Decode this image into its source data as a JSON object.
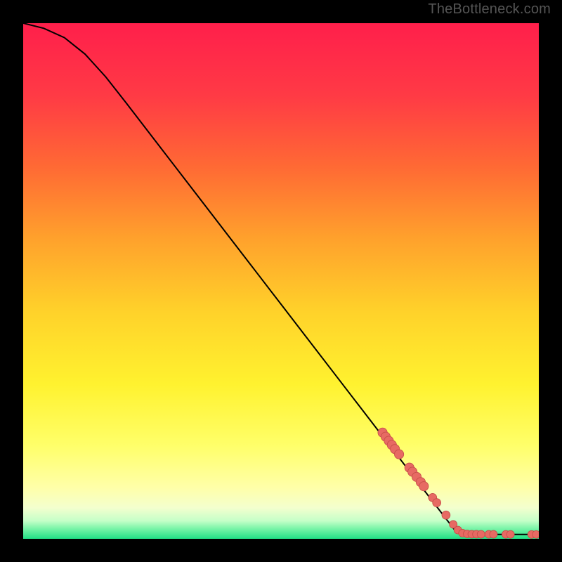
{
  "watermark": "TheBottleneck.com",
  "colors": {
    "gradient_top": "#ff1f4b",
    "gradient_mid_upper": "#ff8a2a",
    "gradient_mid": "#ffe12a",
    "gradient_low": "#ffff9a",
    "gradient_green": "#29e58b",
    "line": "#000000",
    "dot_fill": "#e76a63",
    "dot_stroke": "#c74f49",
    "background": "#000000"
  },
  "chart_data": {
    "type": "line",
    "title": "",
    "xlabel": "",
    "ylabel": "",
    "xlim": [
      0,
      100
    ],
    "ylim": [
      0,
      100
    ],
    "curve": [
      {
        "x": 0,
        "y": 100
      },
      {
        "x": 4,
        "y": 99
      },
      {
        "x": 8,
        "y": 97.2
      },
      {
        "x": 12,
        "y": 94.0
      },
      {
        "x": 16,
        "y": 89.6
      },
      {
        "x": 20,
        "y": 84.5
      },
      {
        "x": 25,
        "y": 78.0
      },
      {
        "x": 30,
        "y": 71.5
      },
      {
        "x": 35,
        "y": 65.0
      },
      {
        "x": 40,
        "y": 58.5
      },
      {
        "x": 45,
        "y": 52.0
      },
      {
        "x": 50,
        "y": 45.5
      },
      {
        "x": 55,
        "y": 39.0
      },
      {
        "x": 60,
        "y": 32.5
      },
      {
        "x": 65,
        "y": 26.0
      },
      {
        "x": 70,
        "y": 19.5
      },
      {
        "x": 75,
        "y": 13.0
      },
      {
        "x": 80,
        "y": 6.5
      },
      {
        "x": 84,
        "y": 1.3
      },
      {
        "x": 86,
        "y": 0.9
      },
      {
        "x": 90,
        "y": 0.85
      },
      {
        "x": 95,
        "y": 0.85
      },
      {
        "x": 100,
        "y": 0.85
      }
    ],
    "clusters": [
      {
        "cx": 69.7,
        "cy": 20.6,
        "r": 0.9
      },
      {
        "cx": 70.3,
        "cy": 19.8,
        "r": 0.9
      },
      {
        "cx": 70.9,
        "cy": 19.0,
        "r": 0.9
      },
      {
        "cx": 71.5,
        "cy": 18.2,
        "r": 0.9
      },
      {
        "cx": 72.1,
        "cy": 17.4,
        "r": 0.9
      },
      {
        "cx": 72.9,
        "cy": 16.4,
        "r": 0.9
      },
      {
        "cx": 74.9,
        "cy": 13.8,
        "r": 0.9
      },
      {
        "cx": 75.5,
        "cy": 13.0,
        "r": 0.9
      },
      {
        "cx": 76.3,
        "cy": 12.0,
        "r": 0.9
      },
      {
        "cx": 77.1,
        "cy": 11.0,
        "r": 0.9
      },
      {
        "cx": 77.7,
        "cy": 10.2,
        "r": 0.9
      },
      {
        "cx": 79.4,
        "cy": 8.0,
        "r": 0.8
      },
      {
        "cx": 80.2,
        "cy": 7.0,
        "r": 0.8
      },
      {
        "cx": 82.0,
        "cy": 4.6,
        "r": 0.8
      },
      {
        "cx": 83.4,
        "cy": 2.8,
        "r": 0.75
      },
      {
        "cx": 84.3,
        "cy": 1.7,
        "r": 0.75
      },
      {
        "cx": 85.2,
        "cy": 1.1,
        "r": 0.75
      },
      {
        "cx": 86.1,
        "cy": 0.95,
        "r": 0.75
      },
      {
        "cx": 87.0,
        "cy": 0.9,
        "r": 0.75
      },
      {
        "cx": 87.9,
        "cy": 0.9,
        "r": 0.75
      },
      {
        "cx": 88.8,
        "cy": 0.88,
        "r": 0.75
      },
      {
        "cx": 90.3,
        "cy": 0.88,
        "r": 0.75
      },
      {
        "cx": 91.2,
        "cy": 0.88,
        "r": 0.75
      },
      {
        "cx": 93.6,
        "cy": 0.86,
        "r": 0.75
      },
      {
        "cx": 94.5,
        "cy": 0.86,
        "r": 0.75
      },
      {
        "cx": 98.6,
        "cy": 0.85,
        "r": 0.75
      },
      {
        "cx": 99.5,
        "cy": 0.85,
        "r": 0.75
      }
    ],
    "gradient_bands": [
      {
        "from": 100,
        "to": 72,
        "color_top": "#ff1f4b",
        "color_bot": "#ff722f"
      },
      {
        "from": 72,
        "to": 45,
        "color_top": "#ff722f",
        "color_bot": "#ffd22a"
      },
      {
        "from": 45,
        "to": 18,
        "color_top": "#ffd22a",
        "color_bot": "#fffb5a"
      },
      {
        "from": 18,
        "to": 8,
        "color_top": "#fffb5a",
        "color_bot": "#ffffb0"
      },
      {
        "from": 8,
        "to": 3,
        "color_top": "#ffffb0",
        "color_bot": "#d9ffc0"
      },
      {
        "from": 3,
        "to": 0,
        "color_top": "#9ef7b8",
        "color_bot": "#22df85"
      }
    ]
  }
}
